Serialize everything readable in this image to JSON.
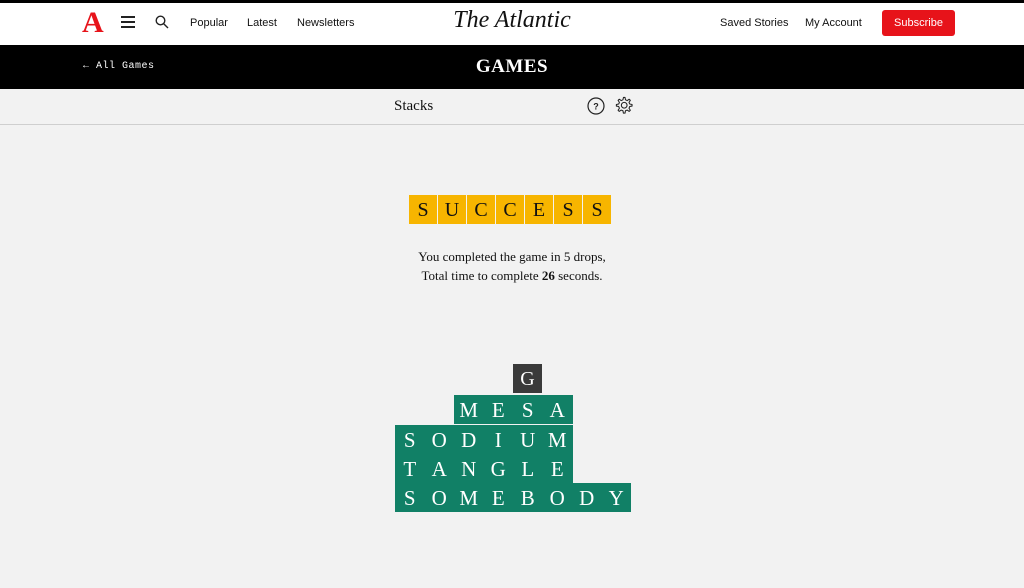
{
  "header": {
    "logo": "A",
    "nav": [
      "Popular",
      "Latest",
      "Newsletters"
    ],
    "brand": "The Atlantic",
    "saved_stories": "Saved Stories",
    "my_account": "My Account",
    "subscribe": "Subscribe"
  },
  "games_bar": {
    "back_label": "← All Games",
    "title": "GAMES"
  },
  "stacks_bar": {
    "title": "Stacks",
    "help_icon": "help-circle-icon",
    "settings_icon": "gear-icon"
  },
  "colors": {
    "accent_red": "#e7131a",
    "tile_yellow": "#f7b500",
    "tile_green": "#118066",
    "tile_dark": "#3a3a3a"
  },
  "result": {
    "banner_letters": [
      "S",
      "U",
      "C",
      "C",
      "E",
      "S",
      "S"
    ],
    "line1": "You completed the game in 5 drops,",
    "line2_prefix": "Total time to complete",
    "seconds": "26",
    "line2_suffix": "seconds."
  },
  "stack": {
    "falling_tile": "G",
    "words": [
      "MESA",
      "SODIUM",
      "TANGLE",
      "SOMEBODY"
    ]
  }
}
